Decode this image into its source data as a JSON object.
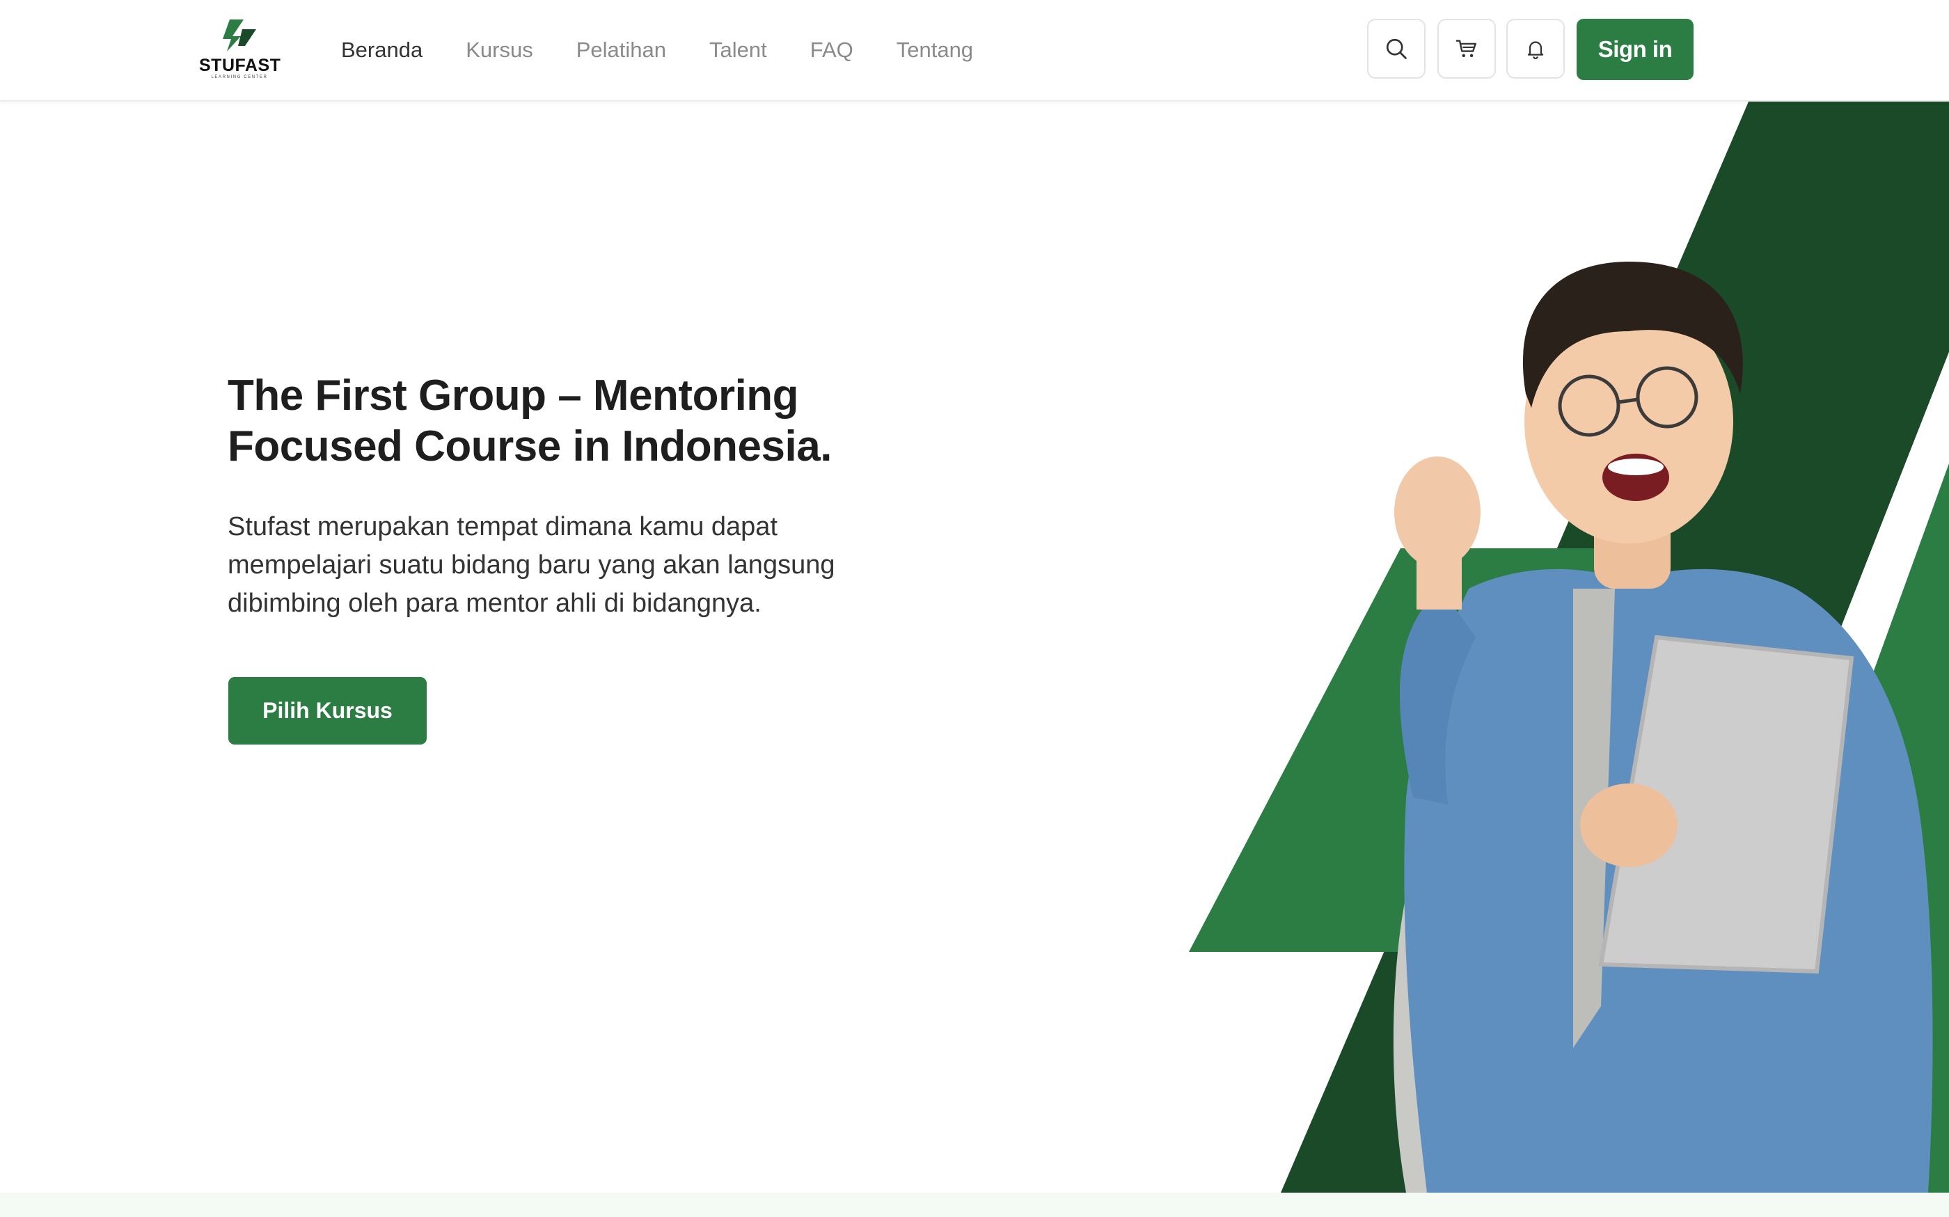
{
  "brand": {
    "name": "STUFAST",
    "tagline": "LEARNING CENTER"
  },
  "nav": {
    "items": [
      {
        "label": "Beranda",
        "active": true
      },
      {
        "label": "Kursus",
        "active": false
      },
      {
        "label": "Pelatihan",
        "active": false
      },
      {
        "label": "Talent",
        "active": false
      },
      {
        "label": "FAQ",
        "active": false
      },
      {
        "label": "Tentang",
        "active": false
      }
    ]
  },
  "actions": {
    "search_icon": "search-icon",
    "cart_icon": "cart-icon",
    "bell_icon": "bell-icon",
    "signin_label": "Sign in"
  },
  "hero": {
    "title_line1": "The First Group – Mentoring",
    "title_line2": "Focused Course in Indonesia.",
    "description_line1": "Stufast merupakan tempat dimana kamu dapat",
    "description_line2": "mempelajari suatu bidang baru yang akan langsung",
    "description_line3": "dibimbing oleh para mentor ahli di bidangnya.",
    "cta_label": "Pilih Kursus"
  },
  "colors": {
    "primary": "#2b7d43",
    "dark_green": "#1b4a28",
    "text": "#1e1e1e",
    "muted": "#8a8a8a"
  }
}
